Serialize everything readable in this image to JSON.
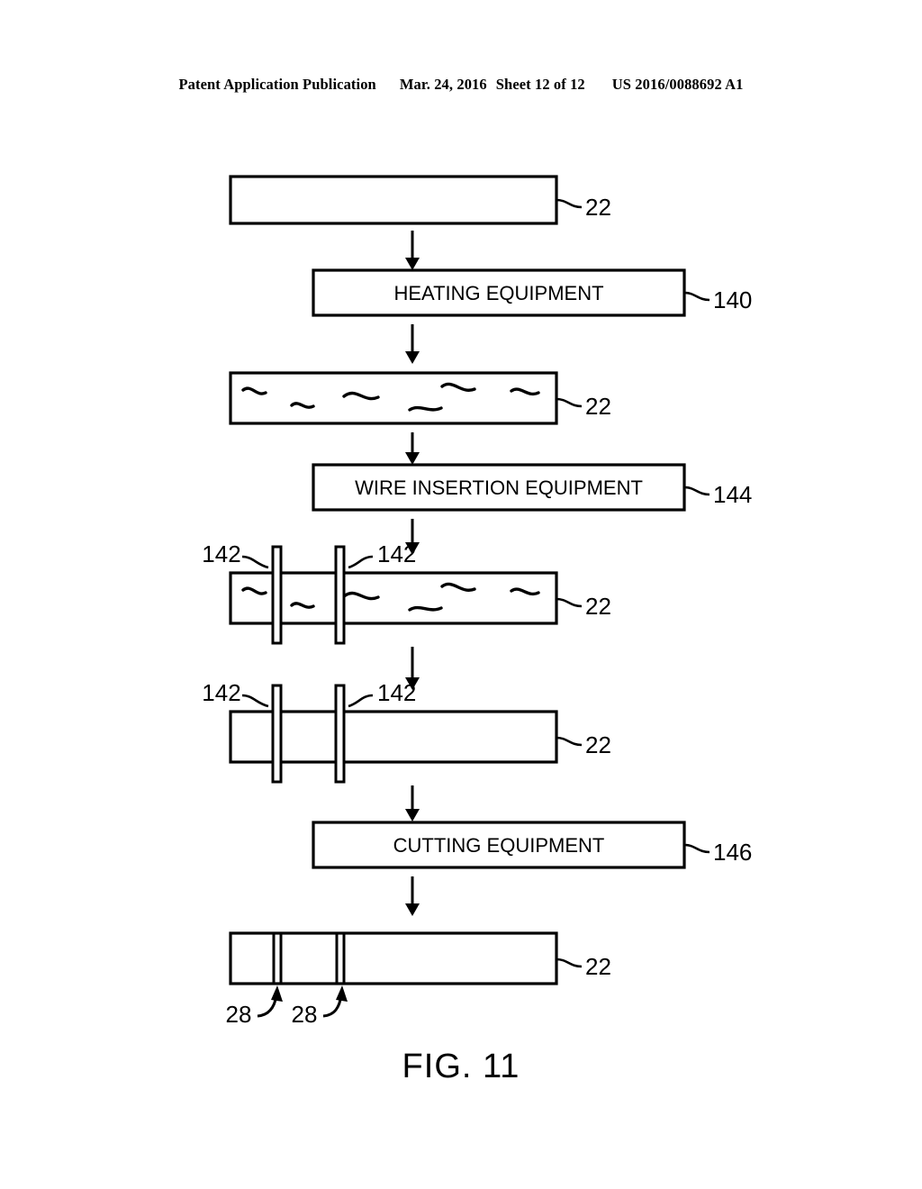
{
  "header": {
    "publication": "Patent Application Publication",
    "date": "Mar. 24, 2016",
    "sheet": "Sheet 12 of 12",
    "pub_number": "US 2016/0088692 A1"
  },
  "figure": {
    "caption": "FIG. 11",
    "colors": {
      "line": "#000000",
      "background": "#ffffff"
    },
    "stages": [
      {
        "id": "stage-1-blank-substrate",
        "type": "substrate",
        "label": "",
        "ref": "22",
        "has_squiggles": false,
        "has_wires": false,
        "has_cuts": false
      },
      {
        "id": "stage-2-heating-equipment",
        "type": "equipment",
        "label": "HEATING EQUIPMENT",
        "ref": "140"
      },
      {
        "id": "stage-3-heated-substrate",
        "type": "substrate",
        "label": "",
        "ref": "22",
        "has_squiggles": true,
        "has_wires": false,
        "has_cuts": false
      },
      {
        "id": "stage-4-wire-insertion-equipment",
        "type": "equipment",
        "label": "WIRE INSERTION EQUIPMENT",
        "ref": "144"
      },
      {
        "id": "stage-5-wired-substrate",
        "type": "substrate",
        "label": "",
        "ref": "22",
        "has_squiggles": true,
        "has_wires": true,
        "wire_refs": [
          "142",
          "142"
        ],
        "has_cuts": false
      },
      {
        "id": "stage-6-consolidated-substrate",
        "type": "substrate",
        "label": "",
        "ref": "22",
        "has_squiggles": false,
        "has_wires": true,
        "wire_refs": [
          "142",
          "142"
        ],
        "has_cuts": false
      },
      {
        "id": "stage-7-cutting-equipment",
        "type": "equipment",
        "label": "CUTTING EQUIPMENT",
        "ref": "146"
      },
      {
        "id": "stage-8-cut-substrate",
        "type": "substrate",
        "label": "",
        "ref": "22",
        "has_squiggles": false,
        "has_wires": false,
        "has_cuts": true,
        "cut_refs": [
          "28",
          "28"
        ]
      }
    ]
  }
}
